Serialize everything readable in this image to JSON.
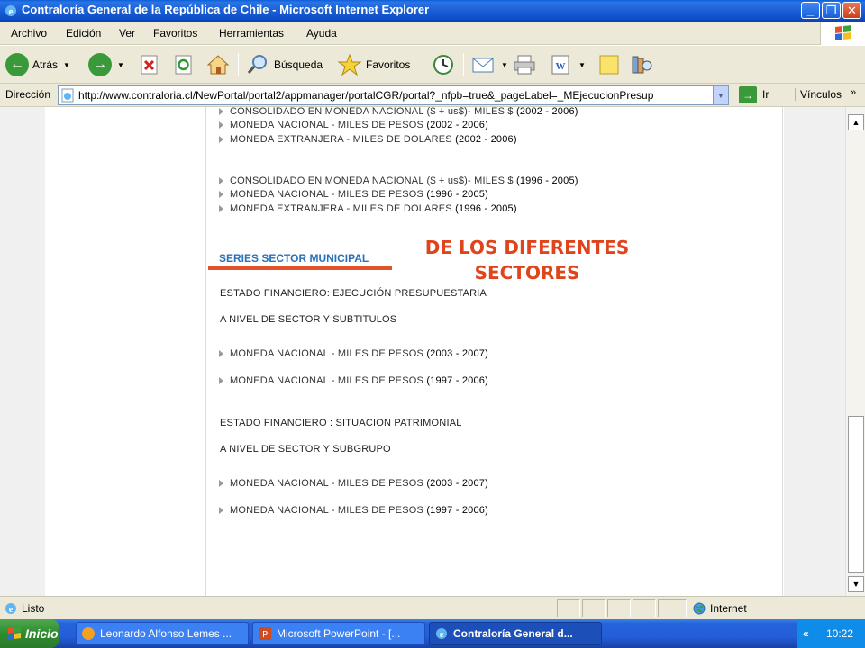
{
  "window": {
    "title": "Contraloría General de la República de Chile - Microsoft Internet Explorer",
    "buttons": {
      "minimize": "_",
      "maximize": "❐",
      "close": "✕"
    }
  },
  "menu": [
    "Archivo",
    "Edición",
    "Ver",
    "Favoritos",
    "Herramientas",
    "Ayuda"
  ],
  "toolbar": {
    "back_label": "Atrás",
    "search_label": "Búsqueda",
    "favorites_label": "Favoritos"
  },
  "address": {
    "label": "Dirección",
    "url": "http://www.contraloria.cl/NewPortal/portal2/appmanager/portalCGR/portal?_nfpb=true&_pageLabel=_MEjecucionPresup",
    "go_label": "Ir",
    "links_label": "Vínculos"
  },
  "content": {
    "group1": [
      {
        "text": "CONSOLIDADO EN MONEDA NACIONAL ($ + us$)- MILES $",
        "years": "(2002 - 2006)"
      },
      {
        "text": "MONEDA NACIONAL - MILES DE PESOS",
        "years": "(2002 - 2006)"
      },
      {
        "text": "MONEDA EXTRANJERA - MILES DE DOLARES",
        "years": "(2002 - 2006)"
      }
    ],
    "group2": [
      {
        "text": "CONSOLIDADO EN MONEDA NACIONAL ($ + us$)- MILES $",
        "years": "(1996 - 2005)"
      },
      {
        "text": "MONEDA NACIONAL - MILES DE PESOS",
        "years": "(1996 - 2005)"
      },
      {
        "text": "MONEDA EXTRANJERA - MILES DE DOLARES",
        "years": "(1996 - 2005)"
      }
    ],
    "series_title": "SERIES SECTOR MUNICIPAL",
    "annotation": "DE LOS DIFERENTES SECTORES",
    "section1": {
      "heading": "ESTADO FINANCIERO: EJECUCIÓN PRESUPUESTARIA",
      "subheading": "A NIVEL DE SECTOR Y SUBTITULOS",
      "links": [
        {
          "text": "MONEDA NACIONAL - MILES DE PESOS",
          "years": "(2003 - 2007)"
        },
        {
          "text": "MONEDA NACIONAL - MILES DE PESOS",
          "years": "(1997 - 2006)"
        }
      ]
    },
    "section2": {
      "heading": "ESTADO FINANCIERO : SITUACION PATRIMONIAL",
      "subheading": "A NIVEL DE SECTOR Y SUBGRUPO",
      "links": [
        {
          "text": "MONEDA NACIONAL - MILES DE PESOS",
          "years": "(2003 - 2007)"
        },
        {
          "text": "MONEDA NACIONAL - MILES DE PESOS",
          "years": "(1997 - 2006)"
        }
      ]
    }
  },
  "status": {
    "text": "Listo",
    "zone": "Internet"
  },
  "taskbar": {
    "start_label": "Inicio",
    "tasks": [
      "Leonardo Alfonso Lemes ...",
      "Microsoft PowerPoint - [...",
      "Contraloría General d..."
    ],
    "tray_chevron": "«",
    "clock": "10:22"
  },
  "colors": {
    "accent_red": "#e0441c",
    "series_blue": "#2c70b8",
    "titlebar_blue": "#1a5fd6"
  }
}
